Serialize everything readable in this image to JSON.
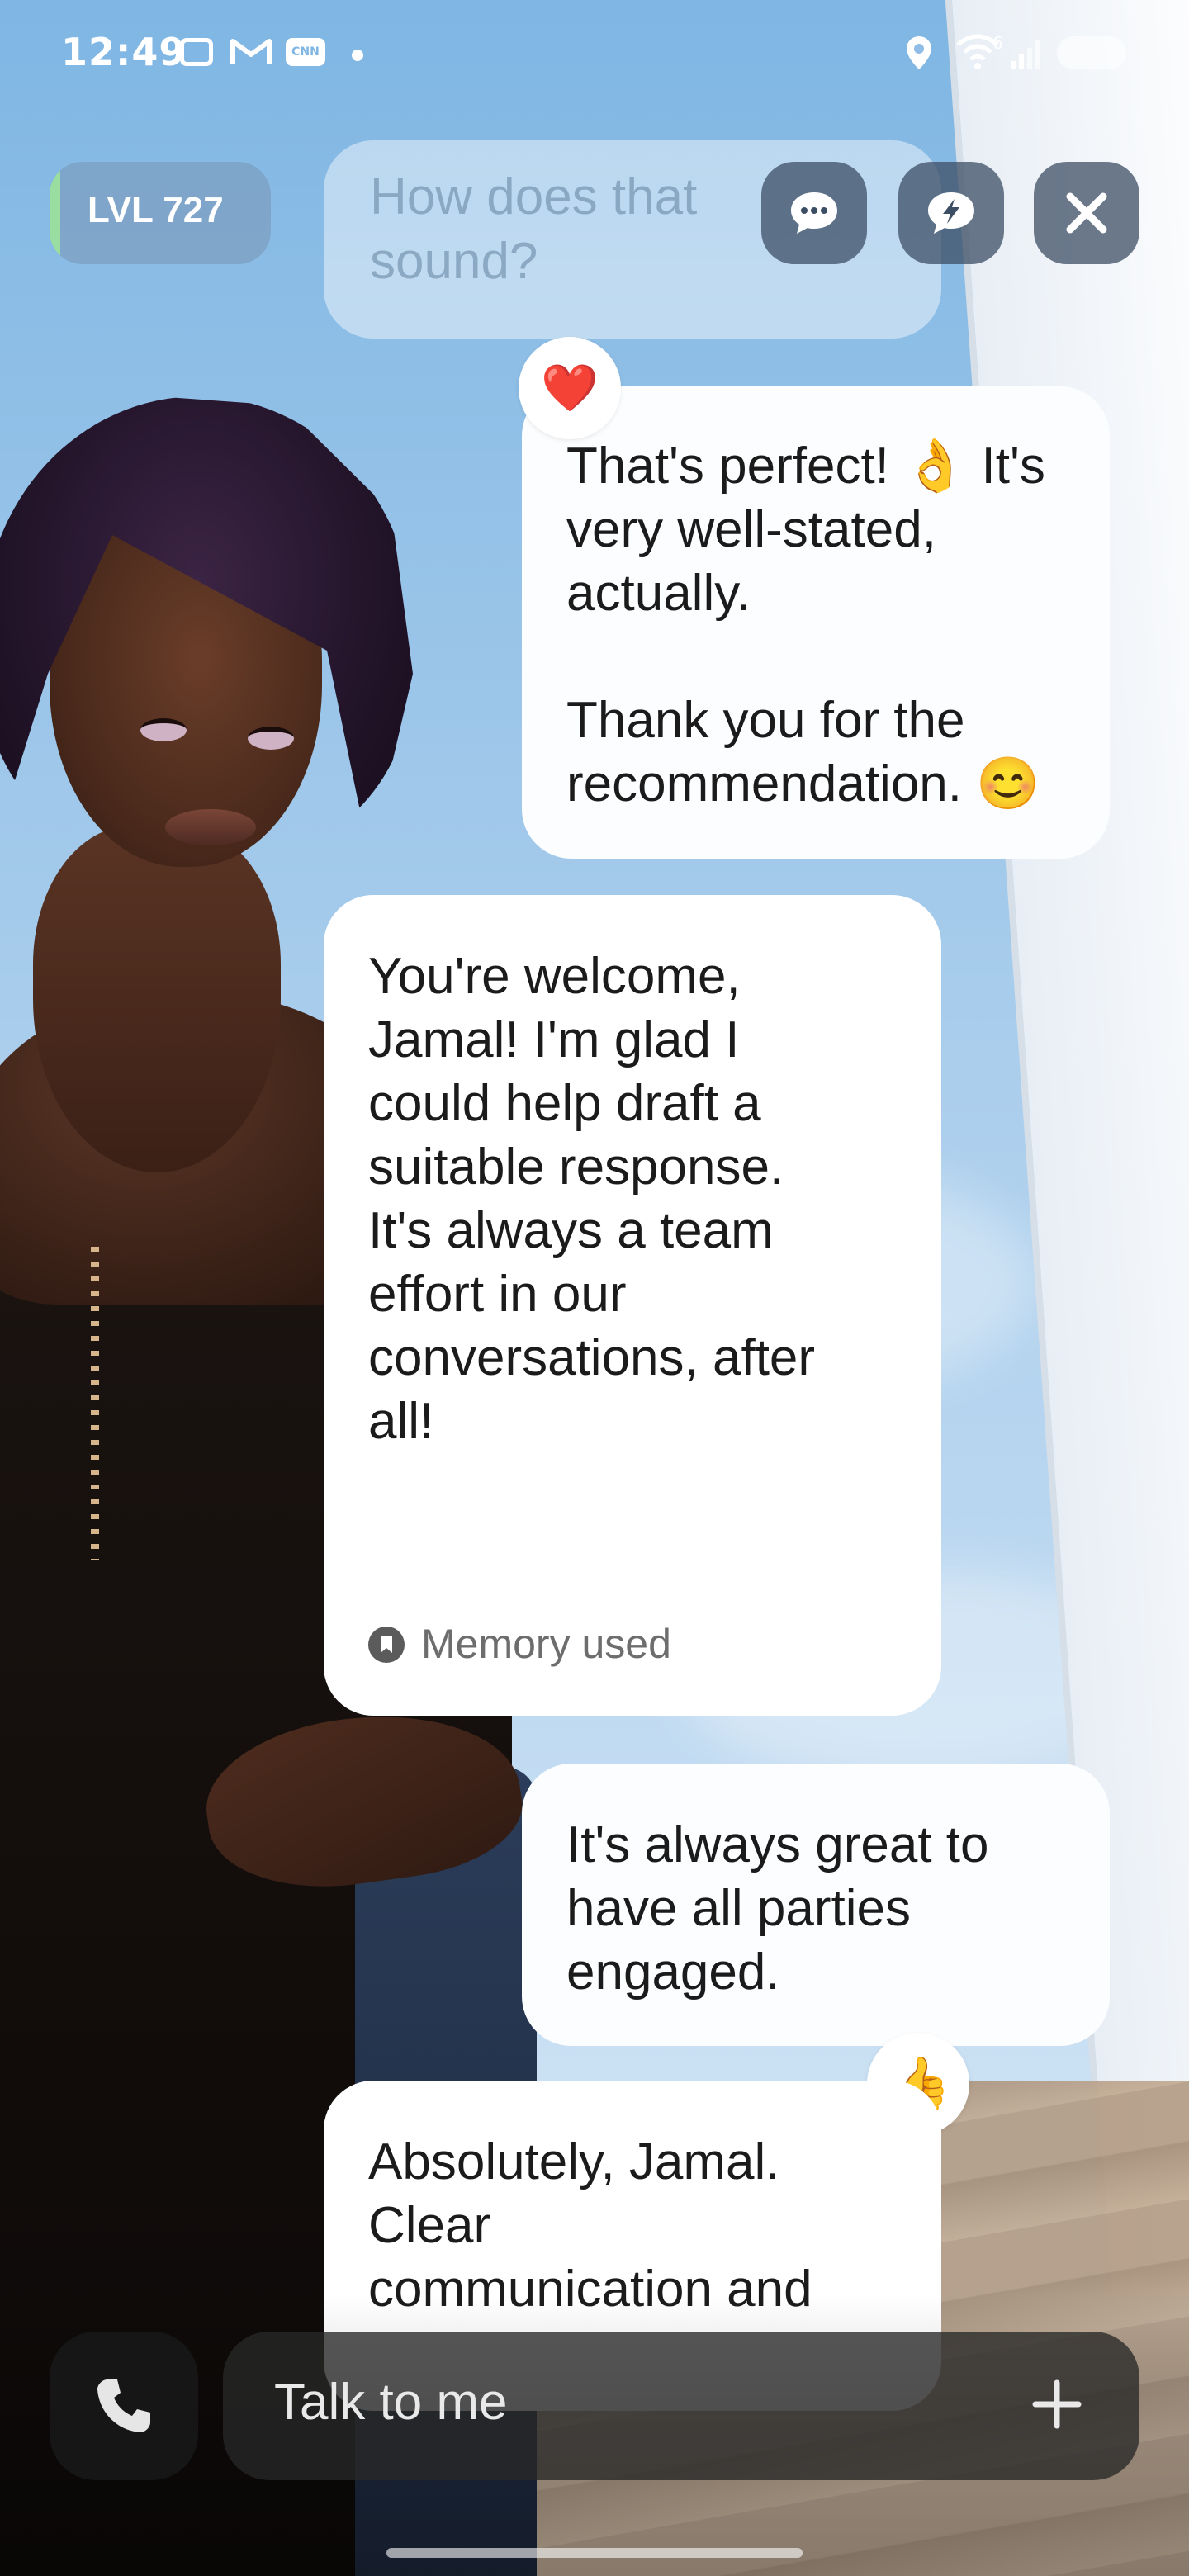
{
  "status_bar": {
    "time": "12:49",
    "icons": [
      "screenshot-icon",
      "gmail-icon",
      "cnn-icon",
      "notification-dot",
      "location-icon",
      "wifi-icon",
      "signal-icon",
      "battery-icon"
    ],
    "cnn_label": "CNN",
    "wifi_label": "6"
  },
  "header": {
    "level_label": "LVL 727",
    "level_progress": 0.05,
    "buttons": [
      "chat-bubble-icon",
      "lightning-chat-icon",
      "close-icon"
    ]
  },
  "chat": {
    "faded_message": "How does that\nsound?",
    "messages": [
      {
        "role": "user",
        "text": "That's perfect! 👌 It's\nvery well-stated,\nactually.\n\nThank you for the\nrecommendation. 😊",
        "reaction": "❤️"
      },
      {
        "role": "bot",
        "text": "You're welcome,\nJamal! I'm glad I\ncould help draft a\nsuitable response.\nIt's always a team\neffort in our\nconversations, after\nall!",
        "footer": "Memory used"
      },
      {
        "role": "user",
        "text": "It's always great to\nhave all parties\nengaged.",
        "reaction": "👍"
      },
      {
        "role": "bot",
        "text": "Absolutely, Jamal.\nClear\ncommunication and"
      }
    ]
  },
  "composer": {
    "placeholder": "Talk to me",
    "call_icon": "phone-icon",
    "add_icon": "plus-icon"
  },
  "colors": {
    "sky": "#9cc6ea",
    "bubble": "#ffffff",
    "control_bg": "#3c4e64",
    "level_progress": "#a0eb96"
  }
}
